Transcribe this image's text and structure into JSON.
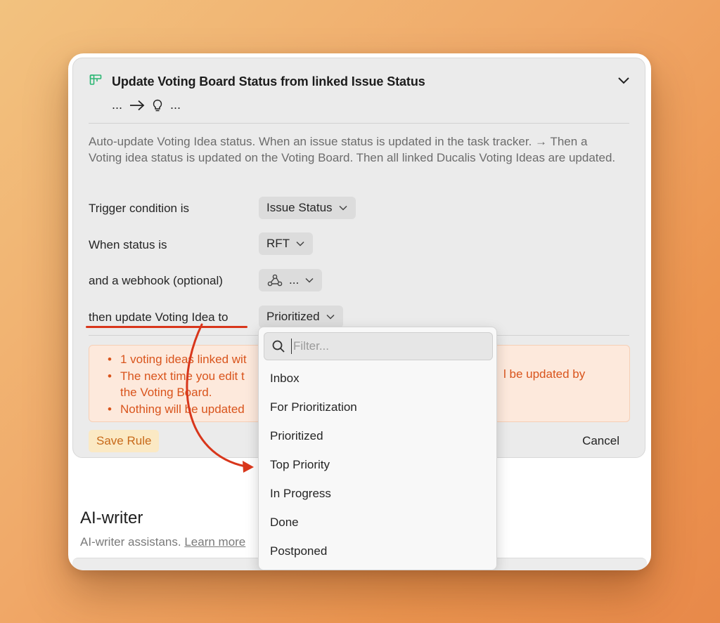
{
  "rule": {
    "title": "Update Voting Board Status from linked Issue Status",
    "flow_left": "...",
    "flow_right": "...",
    "description": "Auto-update Voting Idea status. When an issue status is updated in the task tracker. → Then a Voting idea status is updated on the Voting Board. Then all linked Ducalis Voting Ideas are updated."
  },
  "fields": {
    "trigger_label": "Trigger condition is",
    "trigger_value": "Issue Status",
    "status_label": "When status is",
    "status_value": "RFT",
    "webhook_label": "and a webhook (optional)",
    "webhook_value": "...",
    "update_label": "then update Voting Idea to",
    "update_value": "Prioritized"
  },
  "warning": {
    "item1": "1 voting ideas linked wit",
    "item2": "The next time you edit t",
    "item2_cont": "the Voting Board.",
    "item2_tail": "l be updated by",
    "item3": "Nothing will be updated"
  },
  "actions": {
    "save": "Save Rule",
    "cancel": "Cancel"
  },
  "ai_writer": {
    "title": "AI-writer",
    "subtitle": "AI-writer assistans.",
    "link": "Learn more"
  },
  "dropdown": {
    "placeholder": "Filter...",
    "options": [
      "Inbox",
      "For Prioritization",
      "Prioritized",
      "Top Priority",
      "In Progress",
      "Done",
      "Postponed"
    ]
  },
  "colors": {
    "accent_red": "#d8361b",
    "warning_text": "#d9541c",
    "rule_icon": "#2bb673"
  }
}
